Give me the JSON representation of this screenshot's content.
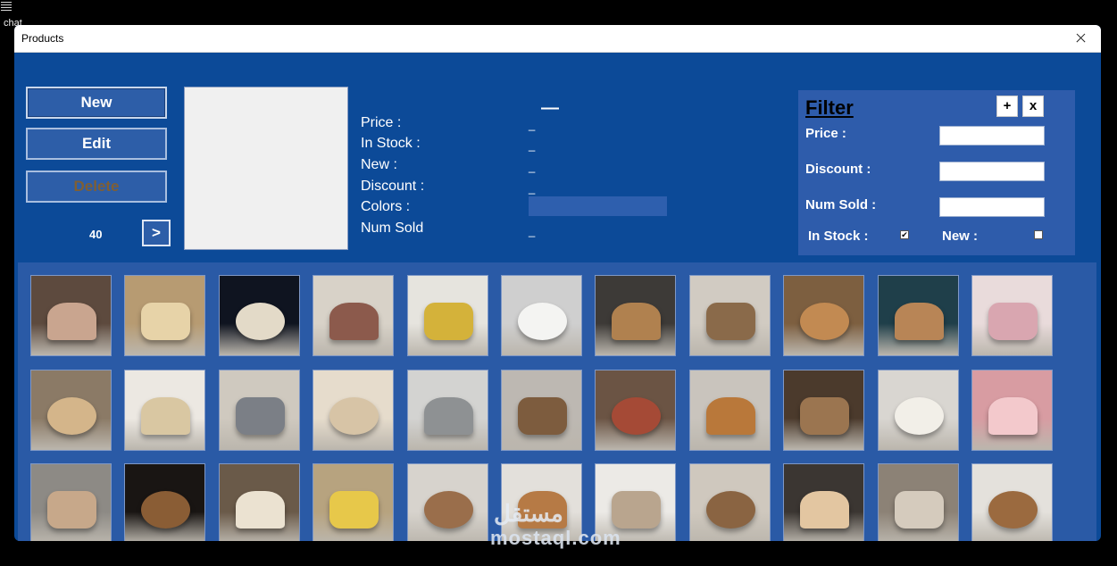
{
  "desktop": {
    "label": "chat"
  },
  "window": {
    "title": "Products"
  },
  "buttons": {
    "new": "New",
    "edit": "Edit",
    "delete": "Delete",
    "next": ">"
  },
  "counter": "40",
  "details": {
    "title_value": "—",
    "price_label": "Price :",
    "price_value": "_",
    "in_stock_label": "In Stock :",
    "in_stock_value": "_",
    "new_label": "New :",
    "new_value": "_",
    "discount_label": "Discount :",
    "discount_value": "_",
    "colors_label": "Colors :",
    "num_sold_label": "Num Sold",
    "num_sold_value": "_"
  },
  "filter": {
    "title": "Filter",
    "plus": "+",
    "close": "x",
    "price_label": "Price :",
    "discount_label": "Discount :",
    "num_sold_label": "Num Sold :",
    "in_stock_label": "In Stock :",
    "new_label": "New :",
    "in_stock_checked": true,
    "new_checked": false
  },
  "gallery": {
    "rows": 3,
    "cols": 11,
    "items": [
      {
        "name": "vintage-armchair-lamp",
        "bg": "#5d4a3e",
        "fg": "#c9a58f"
      },
      {
        "name": "baroque-gold-chairs",
        "bg": "#b79b72",
        "fg": "#e7d3a8"
      },
      {
        "name": "wing-chair-dark",
        "bg": "#0f1420",
        "fg": "#e3dac8"
      },
      {
        "name": "pink-sofa-room",
        "bg": "#d8d2c8",
        "fg": "#8c5a4c"
      },
      {
        "name": "yellow-round-chair",
        "bg": "#e6e4de",
        "fg": "#d4b23a"
      },
      {
        "name": "leaf-white-chair",
        "bg": "#cfcfcf",
        "fg": "#f4f4f2"
      },
      {
        "name": "wave-tv-console",
        "bg": "#3d3a37",
        "fg": "#b0814f"
      },
      {
        "name": "twisted-shelf",
        "bg": "#d1cbc2",
        "fg": "#8a6a4a"
      },
      {
        "name": "wood-wave-shelf",
        "bg": "#7d5f40",
        "fg": "#c28a52"
      },
      {
        "name": "oval-mirror-wood",
        "bg": "#1f3f4a",
        "fg": "#b88556"
      },
      {
        "name": "butterfly-swing",
        "bg": "#e9dbdb",
        "fg": "#d9a6b0"
      },
      {
        "name": "carved-armchair",
        "bg": "#8b7a66",
        "fg": "#d4b58a"
      },
      {
        "name": "white-gold-chaise",
        "bg": "#ece8e2",
        "fg": "#d9c7a2"
      },
      {
        "name": "living-room-grey",
        "bg": "#cfc9bf",
        "fg": "#7b7f86"
      },
      {
        "name": "cream-sofa",
        "bg": "#e6dccc",
        "fg": "#d7c4a6"
      },
      {
        "name": "grey-wingback",
        "bg": "#d3d3d1",
        "fg": "#8e9193"
      },
      {
        "name": "wood-lounge-chair",
        "bg": "#bdb8b2",
        "fg": "#7d5c3e"
      },
      {
        "name": "book-chest",
        "bg": "#6b5444",
        "fg": "#a54a36"
      },
      {
        "name": "wavy-dresser",
        "bg": "#c9c4bd",
        "fg": "#b9783a"
      },
      {
        "name": "tree-bookshelf",
        "bg": "#4b3a2c",
        "fg": "#9b7550"
      },
      {
        "name": "white-console-led",
        "bg": "#d9d6d1",
        "fg": "#f2efe8"
      },
      {
        "name": "pink-tree-room",
        "bg": "#d89ca2",
        "fg": "#f3c9cc"
      },
      {
        "name": "driftwood-chair",
        "bg": "#8d8a85",
        "fg": "#c7a88a"
      },
      {
        "name": "dark-wood-sculpture",
        "bg": "#191513",
        "fg": "#8a5d35"
      },
      {
        "name": "gold-baroque-sofa",
        "bg": "#6a5a49",
        "fg": "#ebe2d1"
      },
      {
        "name": "yellow-boat-chair",
        "bg": "#b7a37f",
        "fg": "#e7c84a"
      },
      {
        "name": "shell-wood-chair",
        "bg": "#d7d3cd",
        "fg": "#9a6e4b"
      },
      {
        "name": "wood-desk-chair",
        "bg": "#e3e0db",
        "fg": "#b67a45"
      },
      {
        "name": "white-cabinet",
        "bg": "#eceae6",
        "fg": "#b9a58e"
      },
      {
        "name": "driftwood-shelf",
        "bg": "#cfc8be",
        "fg": "#8a6442"
      },
      {
        "name": "floor-lamp",
        "bg": "#3b3632",
        "fg": "#e3c6a1"
      },
      {
        "name": "modern-lounge",
        "bg": "#8c8276",
        "fg": "#d5cbbd"
      },
      {
        "name": "wood-coffee-table",
        "bg": "#e4e1dc",
        "fg": "#9b6a3f"
      }
    ]
  },
  "watermark": {
    "arabic": "مستقل",
    "text": "mostaql.com"
  }
}
